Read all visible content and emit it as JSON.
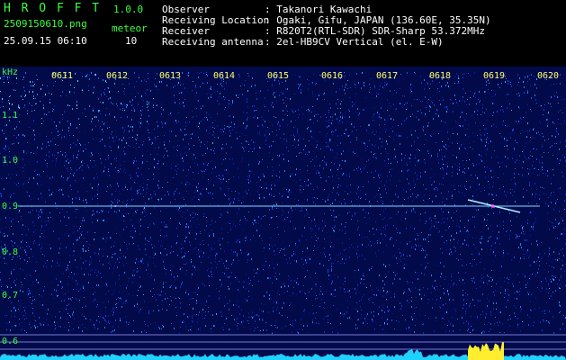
{
  "app": {
    "name": "H R O F F T",
    "version": "1.0.0",
    "file": "2509150610.png",
    "meteor_label": "meteor",
    "meteor_count": "10",
    "datetime": "25.09.15 06:10"
  },
  "info": [
    {
      "label": "Observer",
      "value": ": Takanori Kawachi"
    },
    {
      "label": "Receiving Location",
      "value": ": Ogaki, Gifu, JAPAN (136.60E, 35.35N)"
    },
    {
      "label": "Receiver",
      "value": ": R820T2(RTL-SDR) SDR-Sharp 53.372MHz"
    },
    {
      "label": "Receiving antenna",
      "value": ": 2el-HB9CV Vertical (el. E-W)"
    }
  ],
  "axis": {
    "unit": "kHz",
    "freq_labels": [
      "1.1",
      "1.0",
      "0.9",
      "0.8",
      "0.7",
      "0.6"
    ],
    "time_labels": [
      "0611",
      "0612",
      "0613",
      "0614",
      "0615",
      "0616",
      "0617",
      "0618",
      "0619",
      "0620"
    ]
  },
  "colors": {
    "text_green": "#3cff3c",
    "text_white": "#ffffff",
    "tick_yellow": "#ffff66",
    "noise_blue": "#0a1a9a",
    "carrier_cyan": "#9fe9ff"
  }
}
